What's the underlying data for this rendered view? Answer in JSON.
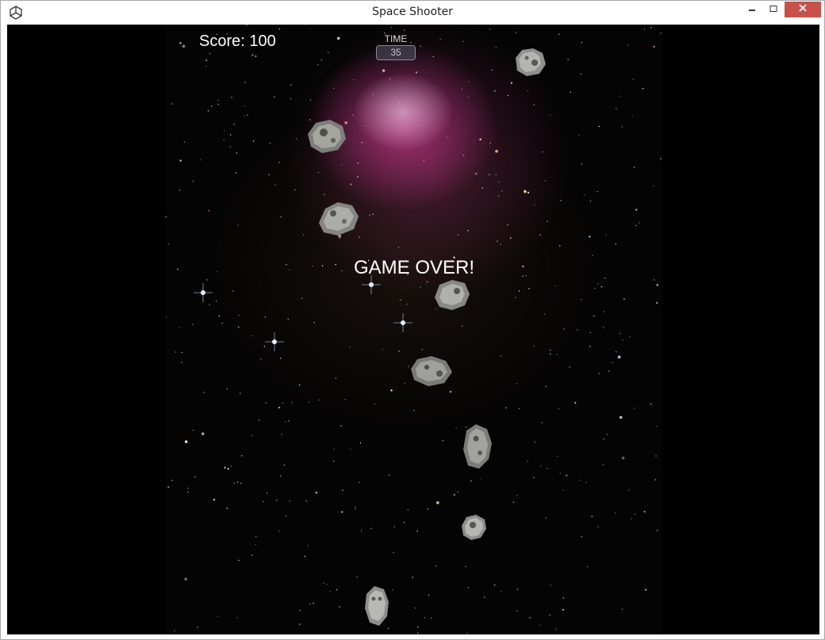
{
  "window": {
    "title": "Space Shooter",
    "minimize_glyph": "🗕",
    "maximize_glyph": "🗖",
    "close_glyph": "✕"
  },
  "hud": {
    "score_text": "Score: 100",
    "time_label": "TIME",
    "time_value": "35"
  },
  "game": {
    "status_text": "GAME OVER!",
    "asteroid_count": 9
  },
  "colors": {
    "close_button": "#c7504a",
    "nebula": "#c6378c",
    "background": "#000000"
  }
}
